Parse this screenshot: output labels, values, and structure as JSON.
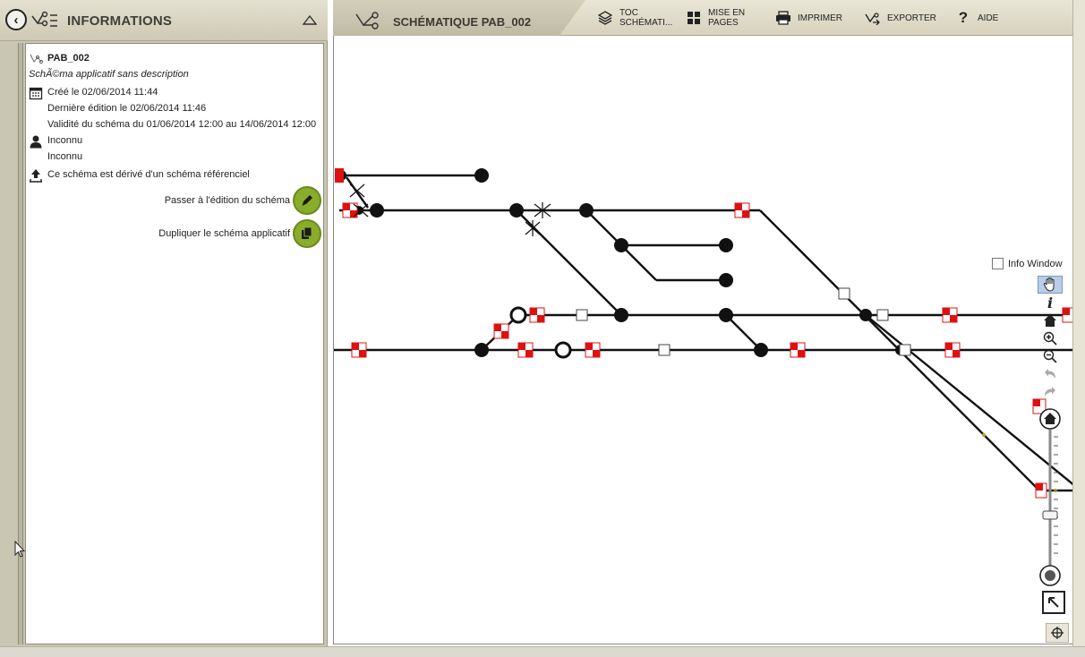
{
  "left_panel": {
    "title": "INFORMATIONS",
    "schema_name": "PAB_002",
    "description": "SchÃ©ma applicatif sans description",
    "created": "Créé le 02/06/2014 11:44",
    "last_edit": "Dernière édition le 02/06/2014 11:46",
    "validity": "Validité du schéma du 01/06/2014 12:00 au 14/06/2014 12:00",
    "author": "Inconnu",
    "editor": "Inconnu",
    "derived": "Ce schéma est dérivé d'un schéma référenciel",
    "edit_action": "Passer à l'édition du schéma",
    "duplicate_action": "Dupliquer le schéma applicatif"
  },
  "toolbar": {
    "schema_title": "SCHÉMATIQUE PAB_002",
    "toc_line1": "TOC",
    "toc_line2": "SCHÉMATI...",
    "layout_line1": "MISE EN",
    "layout_line2": "PAGES",
    "print": "IMPRIMER",
    "export": "EXPORTER",
    "help": "AIDE"
  },
  "map": {
    "info_window_label": "Info Window"
  },
  "colors": {
    "chrome": "#d6d2bd",
    "action_green": "#8aac2b",
    "signal_red": "#dd1122",
    "active_tool": "#b9cde7"
  },
  "icons": [
    "back-arrow-icon",
    "schema-tree-icon",
    "collapse-icon",
    "layers-icon",
    "grid-icon",
    "printer-icon",
    "export-icon",
    "help-icon",
    "calendar-icon",
    "user-icon",
    "derived-icon",
    "pencil-icon",
    "copy-icon",
    "pan-hand-icon",
    "info-icon",
    "home-shape-icon",
    "zoom-in-icon",
    "zoom-out-icon",
    "undo-icon",
    "redo-icon",
    "home-icon",
    "globe-icon",
    "fullscreen-icon",
    "locate-icon"
  ]
}
